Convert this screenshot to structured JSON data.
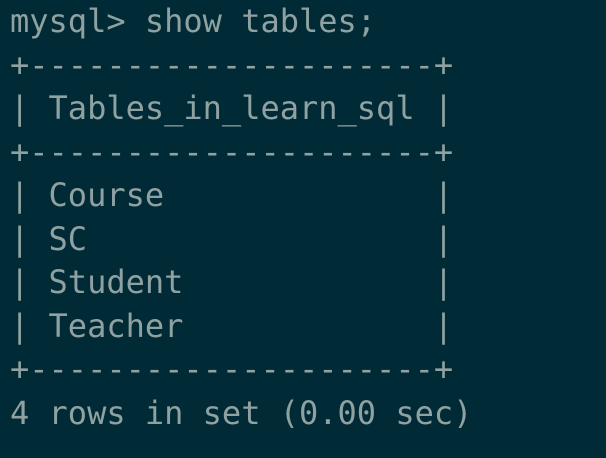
{
  "terminal": {
    "background": "#002b36",
    "foreground": "#8fa1a1",
    "lines": [
      "mysql> show tables;",
      "+---------------------+",
      "| Tables_in_learn_sql |",
      "+---------------------+",
      "| Course              |",
      "| SC                  |",
      "| Student             |",
      "| Teacher             |",
      "+---------------------+",
      "4 rows in set (0.00 sec)"
    ]
  }
}
